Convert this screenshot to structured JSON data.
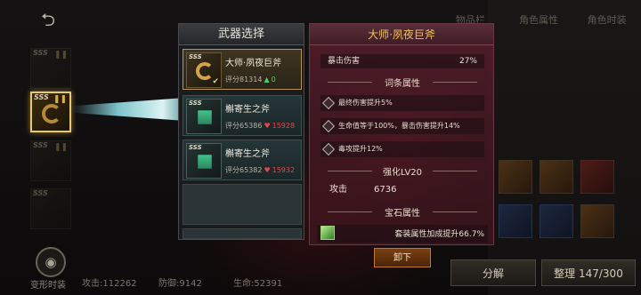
{
  "weapon_select": {
    "title": "武器选择",
    "items": [
      {
        "name": "大师·夙夜巨斧",
        "score": "评分81314",
        "delta": "0",
        "delta_dir": "up",
        "selected": true,
        "rank": "SSS"
      },
      {
        "name": "槲寄生之斧",
        "score": "评分65386",
        "delta": "15928",
        "delta_dir": "down",
        "selected": false,
        "rank": "SSS"
      },
      {
        "name": "槲寄生之斧",
        "score": "评分65382",
        "delta": "15932",
        "delta_dir": "down",
        "selected": false,
        "rank": "SSS"
      }
    ]
  },
  "detail": {
    "title": "大师·夙夜巨斧",
    "crit_label": "暴击伤害",
    "crit_value": "27%",
    "affix_header": "词条属性",
    "affixes": [
      "最终伤害提升5%",
      "生命值等于100%，暴击伤害提升14%",
      "毒攻提升12%"
    ],
    "enhance_header": "强化LV20",
    "attack_label": "攻击",
    "attack_value": "6736",
    "gem_header": "宝石属性",
    "gem_text": "套装属性加成提升66.7%"
  },
  "buttons": {
    "unequip": "卸下",
    "decompose": "分解",
    "arrange": "整理 147/300"
  },
  "tabs": [
    "物品栏",
    "角色属性",
    "角色时装"
  ],
  "left": {
    "eye_label": "变形时装"
  },
  "stats": {
    "attack": "攻击:112262",
    "defense": "防御:9142",
    "hp": "生命:52391"
  },
  "colors": {
    "title_gold": "#f0c060",
    "up": "#4cd06a",
    "down": "#e04848"
  }
}
